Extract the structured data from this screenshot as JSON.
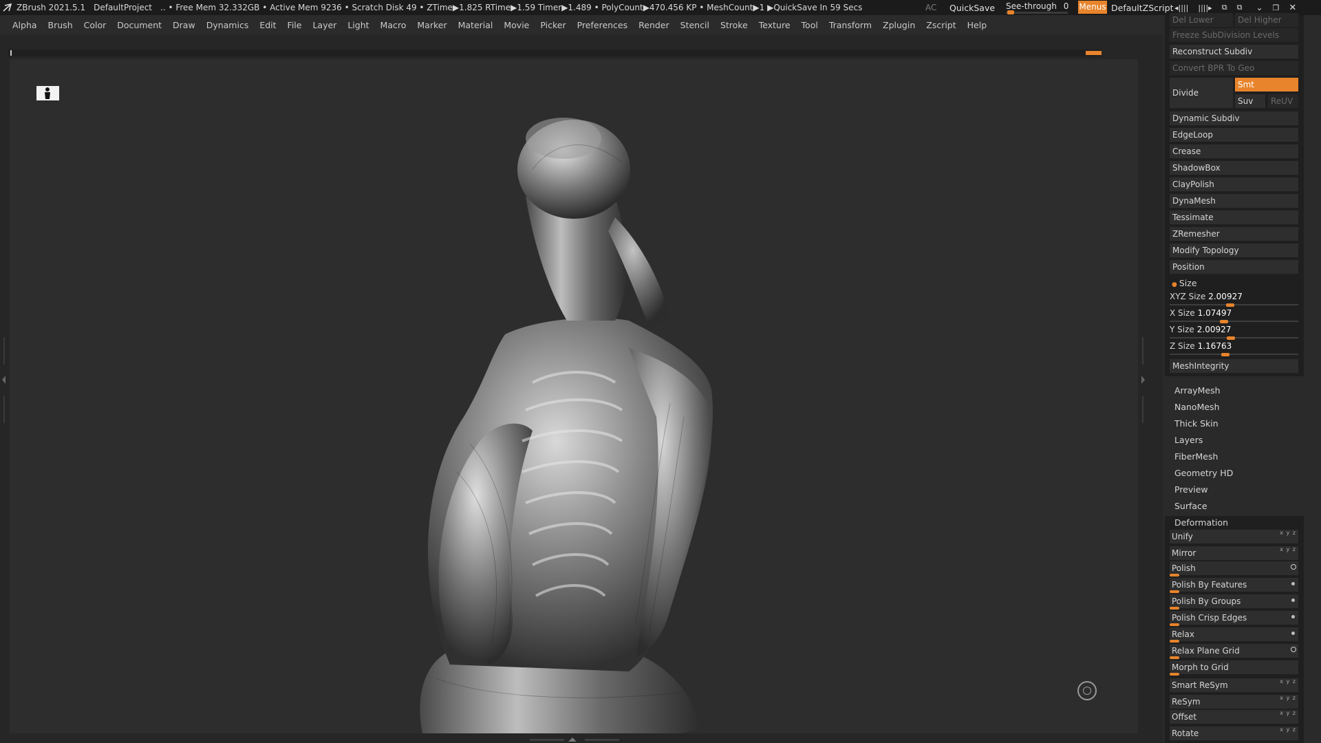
{
  "titlebar": {
    "app": "ZBrush 2021.5.1",
    "project": "DefaultProject",
    "stats": ".. • Free Mem 32.332GB • Active Mem 9236 • Scratch Disk 49 •  ZTime▶1.825 RTime▶1.59 Timer▶1.489 • PolyCount▶470.456 KP  • MeshCount▶1  ▶QuickSave In 59 Secs",
    "ac": "AC",
    "quicksave": "QuickSave",
    "seethrough_label": "See-through",
    "seethrough_value": "0",
    "seethrough_level": 0,
    "menus": "Menus",
    "zscript": "DefaultZScript"
  },
  "menubar": [
    "Alpha",
    "Brush",
    "Color",
    "Document",
    "Draw",
    "Dynamics",
    "Edit",
    "File",
    "Layer",
    "Light",
    "Macro",
    "Marker",
    "Material",
    "Movie",
    "Picker",
    "Preferences",
    "Render",
    "Stencil",
    "Stroke",
    "Texture",
    "Tool",
    "Transform",
    "Zplugin",
    "Zscript",
    "Help"
  ],
  "panel": {
    "del_lower": "Del Lower",
    "del_higher": "Del Higher",
    "freeze": "Freeze SubDivision Levels",
    "reconstruct": "Reconstruct Subdiv",
    "convert": "Convert BPR To Geo",
    "divide": "Divide",
    "smt": "Smt",
    "suv": "Suv",
    "reuv": "ReUV",
    "buttons": [
      "Dynamic Subdiv",
      "EdgeLoop",
      "Crease",
      "ShadowBox",
      "ClayPolish",
      "DynaMesh",
      "Tessimate",
      "ZRemesher",
      "Modify Topology",
      "Position"
    ],
    "size_title": "Size",
    "size_sliders": [
      {
        "label": "XYZ Size",
        "value": "2.00927"
      },
      {
        "label": "X Size",
        "value": "1.07497"
      },
      {
        "label": "Y Size",
        "value": "2.00927"
      },
      {
        "label": "Z Size",
        "value": "1.16763"
      }
    ],
    "meshintegrity": "MeshIntegrity",
    "subpalettes": [
      "ArrayMesh",
      "NanoMesh",
      "Thick Skin",
      "Layers",
      "FiberMesh",
      "Geometry HD",
      "Preview",
      "Surface"
    ],
    "deformation": "Deformation",
    "def_items": [
      {
        "label": "Unify",
        "kind": "xyz"
      },
      {
        "label": "Mirror",
        "kind": "xyz"
      },
      {
        "label": "Polish",
        "kind": "ring"
      },
      {
        "label": "Polish By Features",
        "kind": "dot"
      },
      {
        "label": "Polish By Groups",
        "kind": "dot"
      },
      {
        "label": "Polish Crisp Edges",
        "kind": "dot"
      },
      {
        "label": "Relax",
        "kind": "dot"
      },
      {
        "label": "Relax Plane Grid",
        "kind": "ring"
      },
      {
        "label": "Morph to Grid",
        "kind": "none"
      },
      {
        "label": "Smart ReSym",
        "kind": "xyz"
      },
      {
        "label": "ReSym",
        "kind": "xyz"
      },
      {
        "label": "Offset",
        "kind": "xyz"
      },
      {
        "label": "Rotate",
        "kind": "xyz"
      }
    ],
    "xyz_glyph": "x y z"
  },
  "icons": {
    "app_logo": "zbrush-logo-icon",
    "persp": "perspective-figure-icon",
    "gizmo": "rotate-gizmo-icon"
  },
  "colors": {
    "accent": "#e8842b",
    "bg": "#262626",
    "panel": "#2a2a2a"
  }
}
